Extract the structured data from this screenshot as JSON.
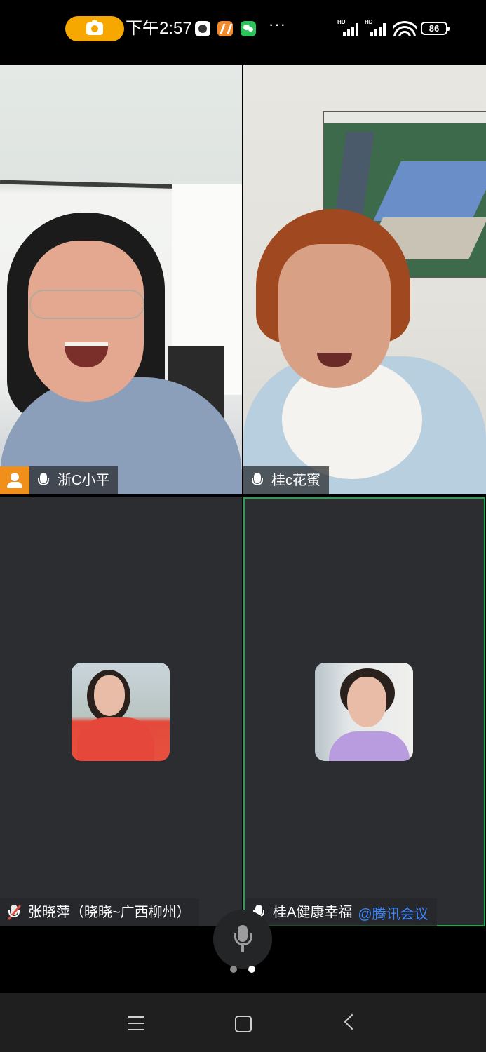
{
  "status_bar": {
    "time": "下午2:57",
    "more": "···",
    "signal_label_1": "HD",
    "signal_label_2": "HD",
    "battery": "86"
  },
  "participants": [
    {
      "name": "浙C小平",
      "is_host": true,
      "muted": false,
      "video": true
    },
    {
      "name": "桂c花蜜",
      "is_host": false,
      "muted": false,
      "video": true
    },
    {
      "name": "张晓萍（晓晓~广西柳州）",
      "is_host": false,
      "muted": true,
      "video": false
    },
    {
      "name": "桂A健康幸福",
      "tag": "@腾讯会议",
      "is_host": false,
      "muted": false,
      "video": false,
      "active_speaker": true
    }
  ],
  "pager": {
    "pages": 2,
    "current": 2
  },
  "colors": {
    "accent": "#1ea84d",
    "host": "#f08f1a",
    "recording": "#f7a800",
    "tag": "#3a86ff"
  }
}
